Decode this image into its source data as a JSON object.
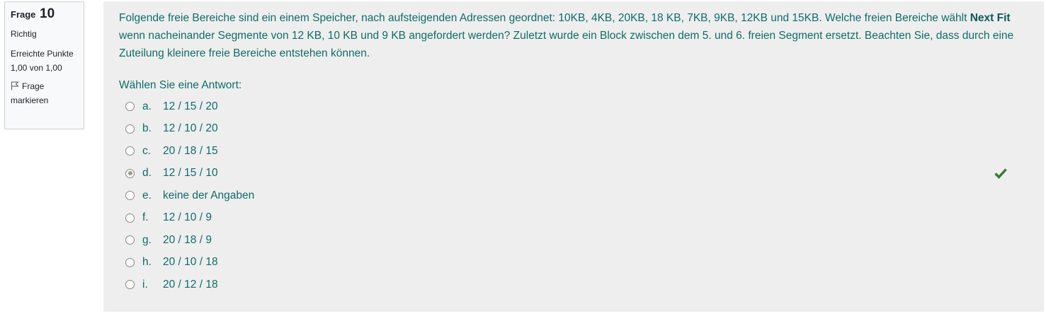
{
  "info": {
    "label": "Frage",
    "number": "10",
    "state": "Richtig",
    "grade": "Erreichte Punkte 1,00 von 1,00",
    "flag_label": "Frage markieren"
  },
  "question": {
    "text_part1": "Folgende freie Bereiche sind ein einem Speicher, nach aufsteigenden Adressen geordnet: 10KB, 4KB, 20KB, 18 KB, 7KB, 9KB, 12KB und 15KB. Welche freien Bereiche wählt ",
    "text_bold": "Next Fit",
    "text_part2": " wenn nacheinander Segmente von 12 KB, 10 KB und 9 KB angefordert werden? Zuletzt wurde ein Block zwischen dem 5. und 6. freien Segment ersetzt. Beachten Sie, dass durch eine Zuteilung kleinere freie Bereiche entstehen können.",
    "prompt": "Wählen Sie eine Antwort:"
  },
  "answers": [
    {
      "letter": "a.",
      "text": "12 / 15 / 20",
      "selected": false
    },
    {
      "letter": "b.",
      "text": "12 / 10 / 20",
      "selected": false
    },
    {
      "letter": "c.",
      "text": "20 / 18 / 15",
      "selected": false
    },
    {
      "letter": "d.",
      "text": "12 / 15 / 10",
      "selected": true,
      "correct": true
    },
    {
      "letter": "e.",
      "text": "keine der Angaben",
      "selected": false
    },
    {
      "letter": "f.",
      "text": "12 / 10 / 9",
      "selected": false
    },
    {
      "letter": "g.",
      "text": "20 / 18 / 9",
      "selected": false
    },
    {
      "letter": "h.",
      "text": "20 / 10 / 18",
      "selected": false
    },
    {
      "letter": "i.",
      "text": "20 / 12 / 18",
      "selected": false
    }
  ],
  "colors": {
    "text": "#0f6c6c",
    "content_bg": "#eeeeee",
    "correct": "#357a32"
  },
  "icons": {
    "flag": "flag-icon",
    "correct": "checkmark-icon"
  }
}
